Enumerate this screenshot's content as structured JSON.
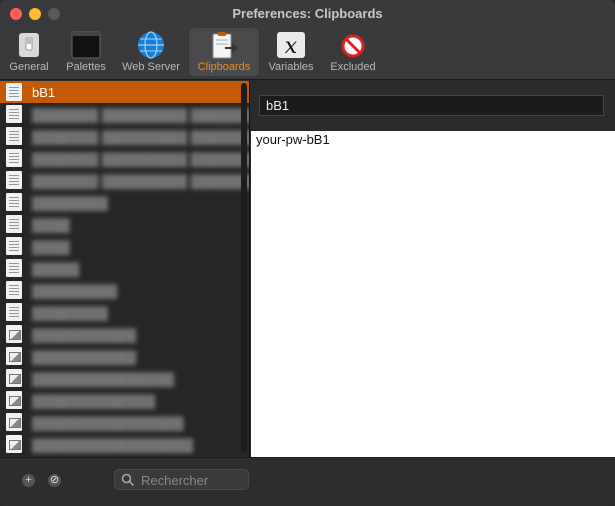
{
  "window": {
    "title": "Preferences: Clipboards"
  },
  "toolbar": {
    "items": [
      {
        "label": "General",
        "icon": "general-icon"
      },
      {
        "label": "Palettes",
        "icon": "palettes-icon"
      },
      {
        "label": "Web Server",
        "icon": "globe-icon"
      },
      {
        "label": "Clipboards",
        "icon": "clipboard-icon",
        "active": true
      },
      {
        "label": "Variables",
        "icon": "variables-icon"
      },
      {
        "label": "Excluded",
        "icon": "excluded-icon"
      }
    ]
  },
  "sidebar": {
    "items": [
      {
        "label": "bB1",
        "type": "text",
        "selected": true
      },
      {
        "label": "▓▓▓▓▓▓▓ ▓▓▓▓▓▓▓▓▓ ▓▓▓▓▓▓▓▓ ▓▓▓▓▓▓",
        "type": "text"
      },
      {
        "label": "▓▓▓▓▓▓▓ ▓▓▓▓▓▓▓▓▓ ▓▓▓▓▓▓▓▓ ▓▓▓▓▓▓",
        "type": "text"
      },
      {
        "label": "▓▓▓▓▓▓▓ ▓▓▓▓▓▓▓▓▓ ▓▓▓▓▓▓▓▓ ▓▓▓▓▓▓",
        "type": "text"
      },
      {
        "label": "▓▓▓▓▓▓▓ ▓▓▓▓▓▓▓▓▓ ▓▓▓▓▓▓▓▓ ▓▓▓▓▓▓",
        "type": "text"
      },
      {
        "label": "▓▓▓▓▓▓▓▓",
        "type": "text"
      },
      {
        "label": "▓▓▓▓",
        "type": "text"
      },
      {
        "label": "▓▓▓▓",
        "type": "text"
      },
      {
        "label": "▓▓▓▓▓",
        "type": "text"
      },
      {
        "label": "▓▓▓▓▓▓▓▓▓",
        "type": "text"
      },
      {
        "label": "▓▓▓▓▓▓▓▓",
        "type": "text"
      },
      {
        "label": "▓▓▓▓▓▓▓▓▓▓▓",
        "type": "image"
      },
      {
        "label": "▓▓▓▓▓▓▓▓▓▓▓",
        "type": "image"
      },
      {
        "label": "▓▓▓▓▓▓▓▓▓▓▓▓▓▓▓",
        "type": "image"
      },
      {
        "label": "▓▓▓▓▓▓▓▓▓▓▓▓▓",
        "type": "image"
      },
      {
        "label": "▓▓▓▓▓▓▓▓▓▓▓▓▓▓▓▓",
        "type": "image"
      },
      {
        "label": "▓▓▓▓▓▓▓▓▓▓▓▓▓▓▓▓▓",
        "type": "image"
      }
    ]
  },
  "detail": {
    "name_value": "bB1",
    "content_text": "your-pw-bB1"
  },
  "bottombar": {
    "add_label": "+",
    "remove_label": "⊘",
    "search_placeholder": "Rechercher"
  },
  "colors": {
    "accent": "#c45a06",
    "active_tab_text": "#f08a24"
  }
}
